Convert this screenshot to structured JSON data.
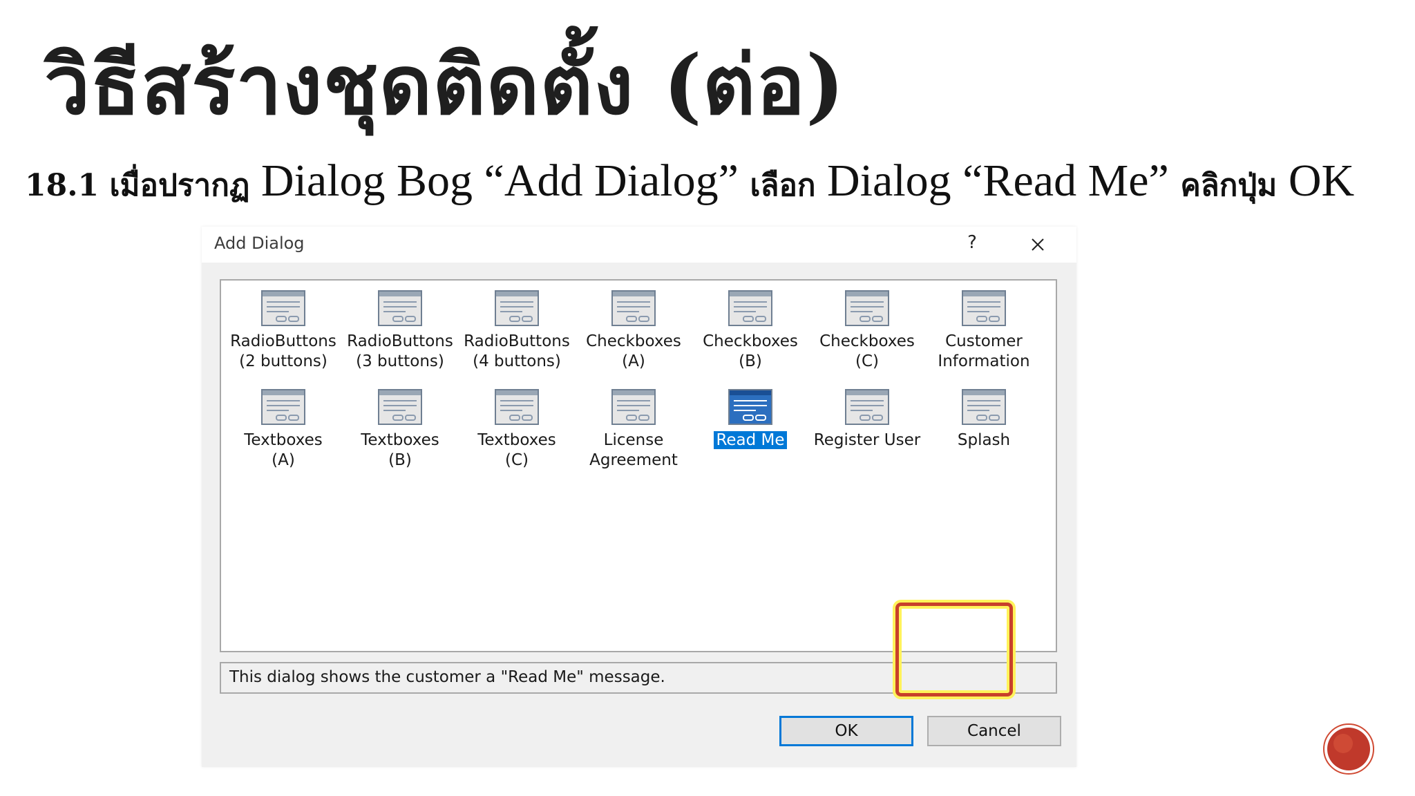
{
  "slide": {
    "title": "วิธีสร้างชุดติดตั้ง (ต่อ)",
    "subtitle_num": "18.1 ",
    "subtitle_th1": "เมื่อปรากฏ",
    "subtitle_en1": " Dialog Bog “Add Dialog” ",
    "subtitle_th2": "เลือก",
    "subtitle_en2": " Dialog “Read Me” ",
    "subtitle_th3": "คลิกปุ่ม",
    "subtitle_en3": " OK"
  },
  "dialog": {
    "title": "Add Dialog",
    "help_label": "?",
    "description": "This dialog shows the customer a \"Read Me\" message.",
    "ok_label": "OK",
    "cancel_label": "Cancel",
    "selected_template": "Read Me",
    "templates": [
      "RadioButtons\n(2 buttons)",
      "RadioButtons\n(3 buttons)",
      "RadioButtons\n(4 buttons)",
      "Checkboxes\n(A)",
      "Checkboxes\n(B)",
      "Checkboxes\n(C)",
      "Customer\nInformation",
      "Textboxes\n(A)",
      "Textboxes\n(B)",
      "Textboxes\n(C)",
      "License\nAgreement",
      "Read Me",
      "Register User",
      "Splash"
    ]
  },
  "colors": {
    "selection": "#0078d7",
    "highlight_border": "#c8402a",
    "highlight_glow": "#fff35a",
    "accent_circle": "#c0392b"
  }
}
